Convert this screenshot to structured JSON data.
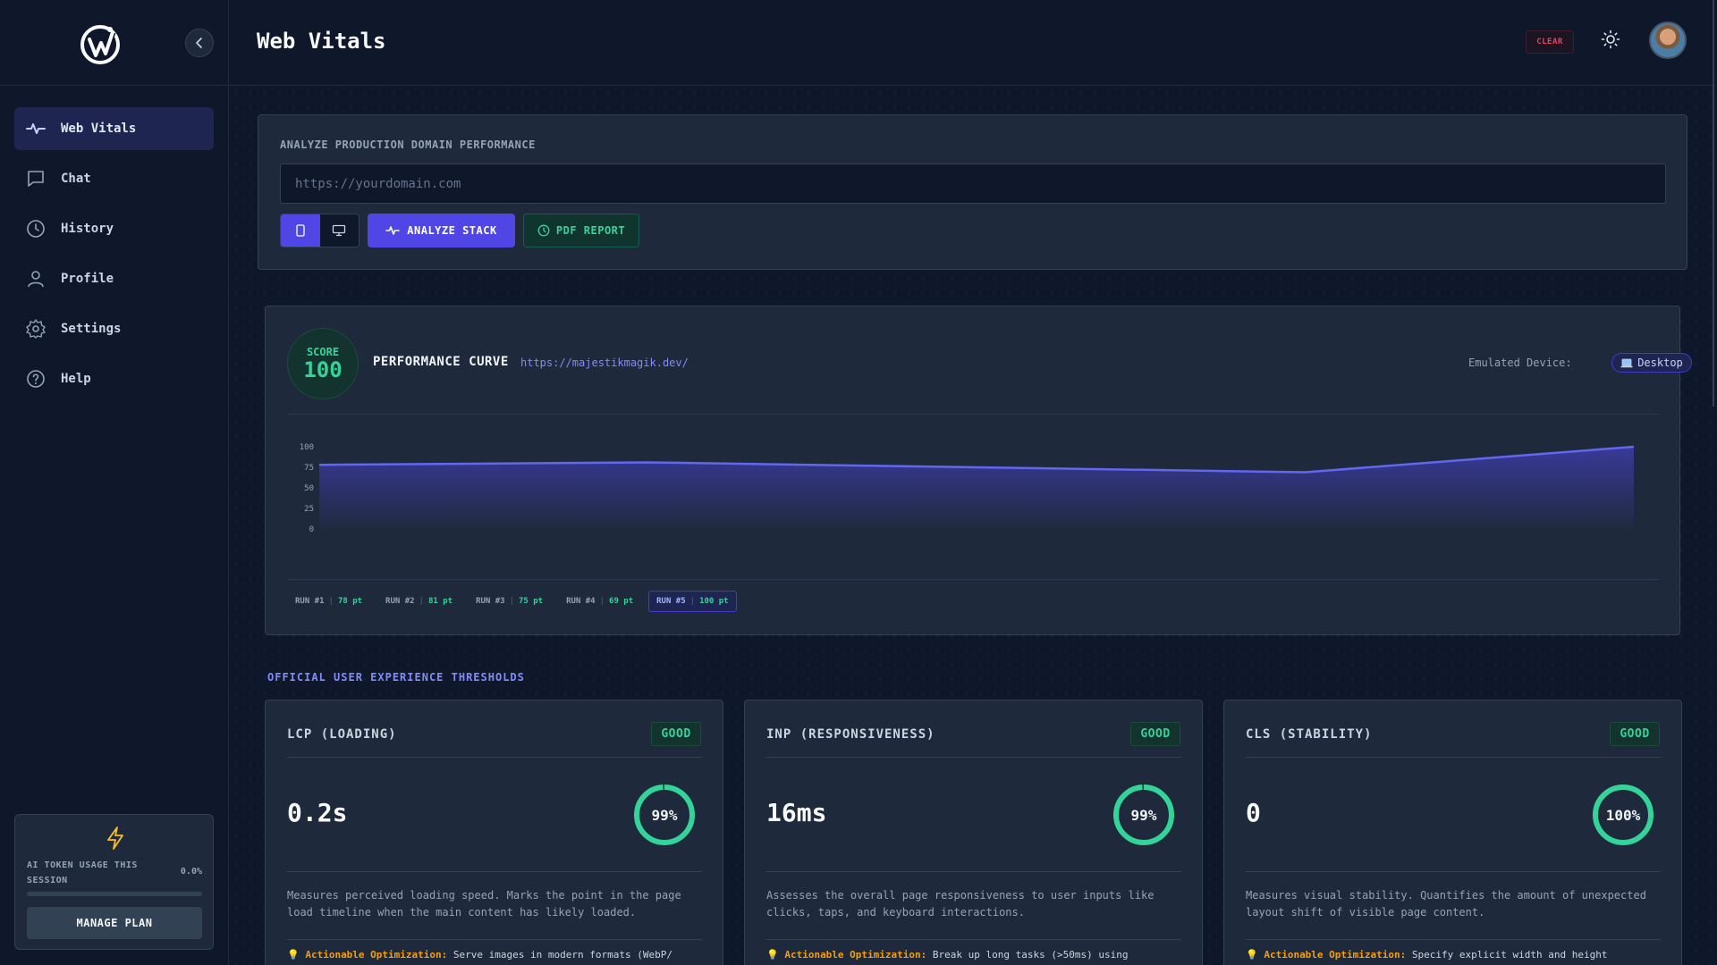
{
  "app": {
    "title": "Web Vitals",
    "clear_label": "CLEAR"
  },
  "sidebar": {
    "items": [
      {
        "label": "Web Vitals",
        "icon": "activity-icon"
      },
      {
        "label": "Chat",
        "icon": "chat-icon"
      },
      {
        "label": "History",
        "icon": "clock-icon"
      },
      {
        "label": "Profile",
        "icon": "user-icon"
      },
      {
        "label": "Settings",
        "icon": "gear-icon"
      },
      {
        "label": "Help",
        "icon": "help-icon"
      }
    ],
    "usage": {
      "label": "AI TOKEN USAGE THIS SESSION",
      "percent": "0.0%",
      "fraction": 0.0,
      "manage_label": "MANAGE PLAN"
    }
  },
  "analyze": {
    "title": "ANALYZE PRODUCTION DOMAIN PERFORMANCE",
    "placeholder": "https://yourdomain.com",
    "value": "",
    "analyze_label": "ANALYZE STACK",
    "pdf_label": "PDF REPORT",
    "selected_device": "mobile"
  },
  "performance": {
    "score_label": "SCORE",
    "score": "100",
    "title": "PERFORMANCE CURVE",
    "url": "https://majestikmagik.dev/",
    "emulated_label": "Emulated Device:",
    "device": "Desktop",
    "device_icon": "laptop-icon",
    "runs": [
      {
        "label": "RUN #1",
        "points": "78 pt"
      },
      {
        "label": "RUN #2",
        "points": "81 pt"
      },
      {
        "label": "RUN #3",
        "points": "75 pt"
      },
      {
        "label": "RUN #4",
        "points": "69 pt"
      },
      {
        "label": "RUN #5",
        "points": "100 pt"
      }
    ],
    "active_run": 4
  },
  "chart_data": {
    "type": "area",
    "categories": [
      "RUN #1",
      "RUN #2",
      "RUN #3",
      "RUN #4",
      "RUN #5"
    ],
    "values": [
      78,
      81,
      75,
      69,
      100
    ],
    "ylim": [
      0,
      100
    ],
    "yticks": [
      0,
      25,
      50,
      75,
      100
    ],
    "grid": false,
    "color": "#6366f1"
  },
  "thresholds": {
    "title": "OFFICIAL USER EXPERIENCE THRESHOLDS",
    "cards": [
      {
        "title": "LCP (LOADING)",
        "badge": "GOOD",
        "value": "0.2s",
        "score": "99%",
        "score_fraction": 0.99,
        "desc": "Measures perceived loading speed. Marks the point in the page load timeline when the main content has likely loaded.",
        "tip_label": "Actionable Optimization:",
        "tip": "Serve images in modern formats (WebP/"
      },
      {
        "title": "INP (RESPONSIVENESS)",
        "badge": "GOOD",
        "value": "16ms",
        "score": "99%",
        "score_fraction": 0.99,
        "desc": "Assesses the overall page responsiveness to user inputs like clicks, taps, and keyboard interactions.",
        "tip_label": "Actionable Optimization:",
        "tip": "Break up long tasks (>50ms) using"
      },
      {
        "title": "CLS (STABILITY)",
        "badge": "GOOD",
        "value": "0",
        "score": "100%",
        "score_fraction": 1.0,
        "desc": "Measures visual stability. Quantifies the amount of unexpected layout shift of visible page content.",
        "tip_label": "Actionable Optimization:",
        "tip": "Specify explicit width and height"
      }
    ]
  },
  "colors": {
    "accent": "#4f46e5",
    "good": "#34d399",
    "warning": "#f59e0b",
    "danger": "#f43f5e",
    "background": "#0f172a",
    "panel": "#1e293b"
  }
}
